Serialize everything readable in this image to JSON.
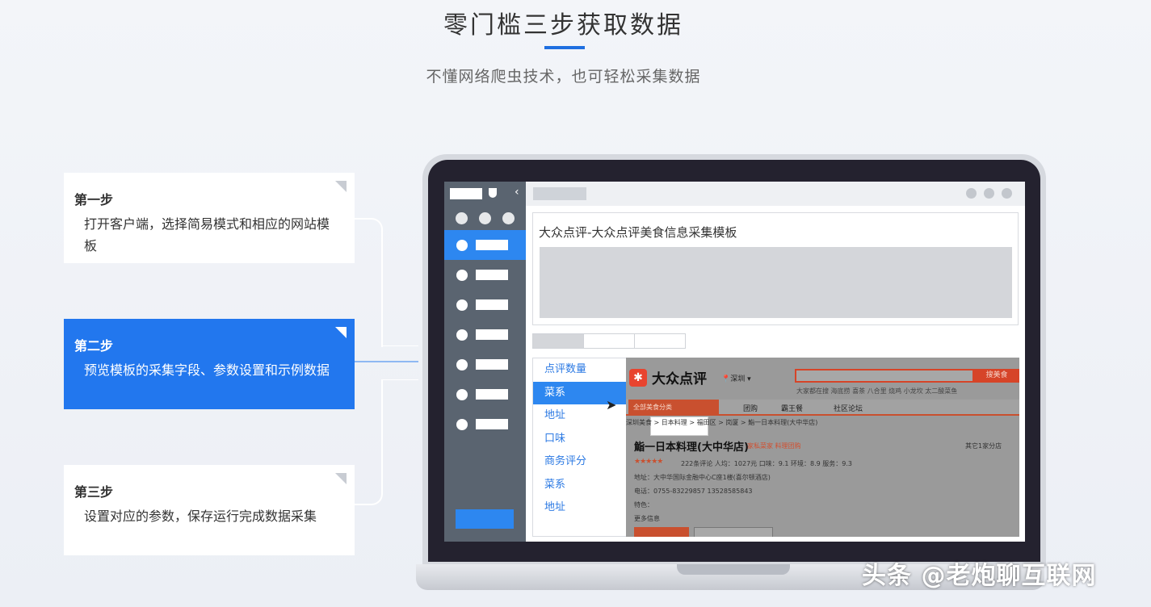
{
  "hero": {
    "title": "零门槛三步获取数据",
    "subtitle": "不懂网络爬虫技术，也可轻松采集数据"
  },
  "steps": [
    {
      "title": "第一步",
      "desc": "打开客户端，选择简易模式和相应的网站模板",
      "active": false
    },
    {
      "title": "第二步",
      "desc": "预览模板的采集字段、参数设置和示例数据",
      "active": true
    },
    {
      "title": "第三步",
      "desc": "设置对应的参数，保存运行完成数据采集",
      "active": false
    }
  ],
  "app": {
    "template_title": "大众点评-大众点评美食信息采集模板",
    "fields": [
      "点评数量",
      "菜系",
      "地址",
      "口味",
      "商务评分",
      "菜系",
      "地址"
    ],
    "active_field_index": 1
  },
  "preview": {
    "logo_text": "大众点评",
    "city": "深圳",
    "search_placeholder": "搜索商户名、地址、菜名、外卖等",
    "search_button": "搜美食",
    "hot_words": "大家都在搜  海底捞  喜茶  八合里  烧鸡  小龙坎  太二酸菜鱼",
    "nav_category": "全部美食分类",
    "nav_links": [
      "团购",
      "霸王餐",
      "社区论坛"
    ],
    "breadcrumb": "深圳美食 > 日本料理 > 福田区 > 岗厦 > 鮨一日本料理(大中华店)",
    "shop_name": "鮨一日本料理(大中华店)",
    "shop_tag": "家私菜家 料理团购",
    "branch": "其它1家分店",
    "stars": "★★★★★",
    "stats": "222条评论  人均：1027元  口味：9.1  环境：8.9  服务：9.3",
    "address": "地址：大中华国际金融中心C座1楼(喜尔顿酒店)",
    "phone": "电话：0755-83229857 13528585843",
    "feature": "特色：",
    "more": "更多信息"
  },
  "watermark": "头条 @老炮聊互联网"
}
